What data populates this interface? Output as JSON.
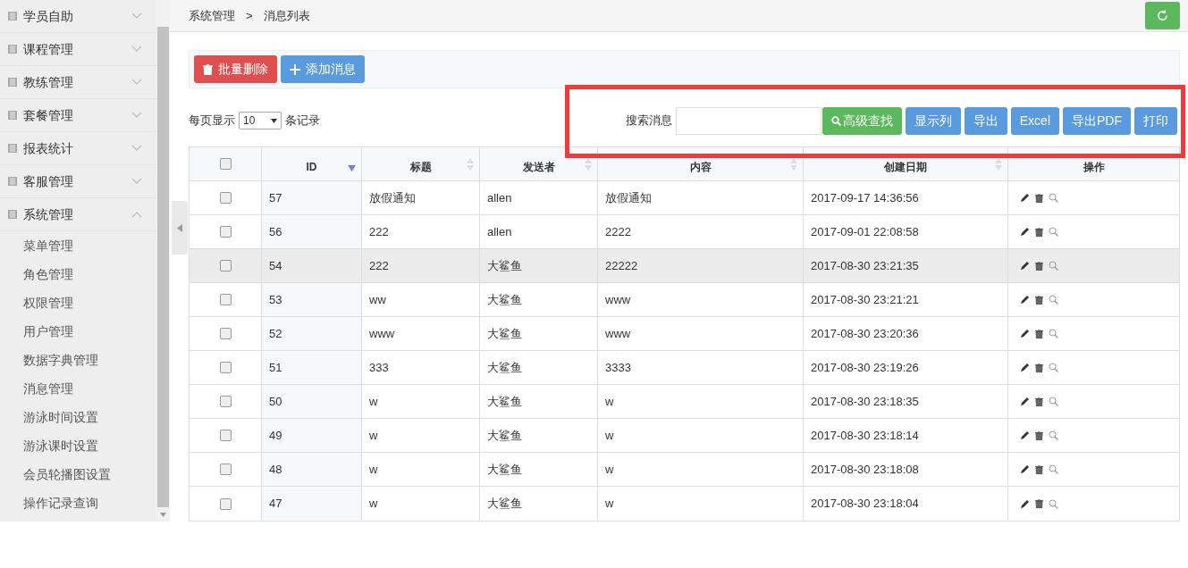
{
  "sidebar": {
    "items": [
      {
        "label": "学员自助",
        "expanded": false
      },
      {
        "label": "课程管理",
        "expanded": false
      },
      {
        "label": "教练管理",
        "expanded": false
      },
      {
        "label": "套餐管理",
        "expanded": false
      },
      {
        "label": "报表统计",
        "expanded": false
      },
      {
        "label": "客服管理",
        "expanded": false
      },
      {
        "label": "系统管理",
        "expanded": true,
        "children": [
          {
            "label": "菜单管理"
          },
          {
            "label": "角色管理"
          },
          {
            "label": "权限管理"
          },
          {
            "label": "用户管理"
          },
          {
            "label": "数据字典管理"
          },
          {
            "label": "消息管理"
          },
          {
            "label": "游泳时间设置"
          },
          {
            "label": "游泳课时设置"
          },
          {
            "label": "会员轮播图设置"
          },
          {
            "label": "操作记录查询"
          }
        ]
      }
    ]
  },
  "breadcrumb": {
    "items": [
      "系统管理",
      "消息列表"
    ],
    "separator": ">"
  },
  "toolbar": {
    "buttons": [
      {
        "label": "批量删除",
        "kind": "danger"
      },
      {
        "label": "添加消息",
        "kind": "primary"
      }
    ]
  },
  "page_size": {
    "prefix": "每页显示",
    "value": "10",
    "suffix": "条记录"
  },
  "search": {
    "label": "搜索消息",
    "buttons": [
      {
        "label": "高级查找",
        "kind": "success"
      },
      {
        "label": "显示列",
        "kind": "primary"
      },
      {
        "label": "导出",
        "kind": "primary"
      },
      {
        "label": "Excel",
        "kind": "primary"
      },
      {
        "label": "导出PDF",
        "kind": "primary"
      },
      {
        "label": "打印",
        "kind": "primary"
      }
    ]
  },
  "table": {
    "select_all": {
      "checked": false
    },
    "columns": [
      {
        "label": "ID",
        "sorted": true
      },
      {
        "label": "标题",
        "sorted": false
      },
      {
        "label": "发送者",
        "sorted": false
      },
      {
        "label": "内容",
        "sorted": false
      },
      {
        "label": "创建日期",
        "sorted": false
      },
      {
        "label": "操作"
      }
    ],
    "rows": [
      {
        "checked": false,
        "highlighted": false,
        "cells": [
          "57",
          "放假通知",
          "allen",
          "放假通知",
          "2017-09-17 14:36:56"
        ]
      },
      {
        "checked": false,
        "highlighted": false,
        "cells": [
          "56",
          "222",
          "allen",
          "2222",
          "2017-09-01 22:08:58"
        ]
      },
      {
        "checked": false,
        "highlighted": true,
        "cells": [
          "54",
          "222",
          "大鲨鱼",
          "22222",
          "2017-08-30 23:21:35"
        ]
      },
      {
        "checked": false,
        "highlighted": false,
        "cells": [
          "53",
          "ww",
          "大鲨鱼",
          "www",
          "2017-08-30 23:21:21"
        ]
      },
      {
        "checked": false,
        "highlighted": false,
        "cells": [
          "52",
          "www",
          "大鲨鱼",
          "www",
          "2017-08-30 23:20:36"
        ]
      },
      {
        "checked": false,
        "highlighted": false,
        "cells": [
          "51",
          "333",
          "大鲨鱼",
          "3333",
          "2017-08-30 23:19:26"
        ]
      },
      {
        "checked": false,
        "highlighted": false,
        "cells": [
          "50",
          "w",
          "大鲨鱼",
          "w",
          "2017-08-30 23:18:35"
        ]
      },
      {
        "checked": false,
        "highlighted": false,
        "cells": [
          "49",
          "w",
          "大鲨鱼",
          "w",
          "2017-08-30 23:18:14"
        ]
      },
      {
        "checked": false,
        "highlighted": false,
        "cells": [
          "48",
          "w",
          "大鲨鱼",
          "w",
          "2017-08-30 23:18:08"
        ]
      },
      {
        "checked": false,
        "highlighted": false,
        "cells": [
          "47",
          "w",
          "大鲨鱼",
          "w",
          "2017-08-30 23:18:04"
        ]
      }
    ]
  }
}
